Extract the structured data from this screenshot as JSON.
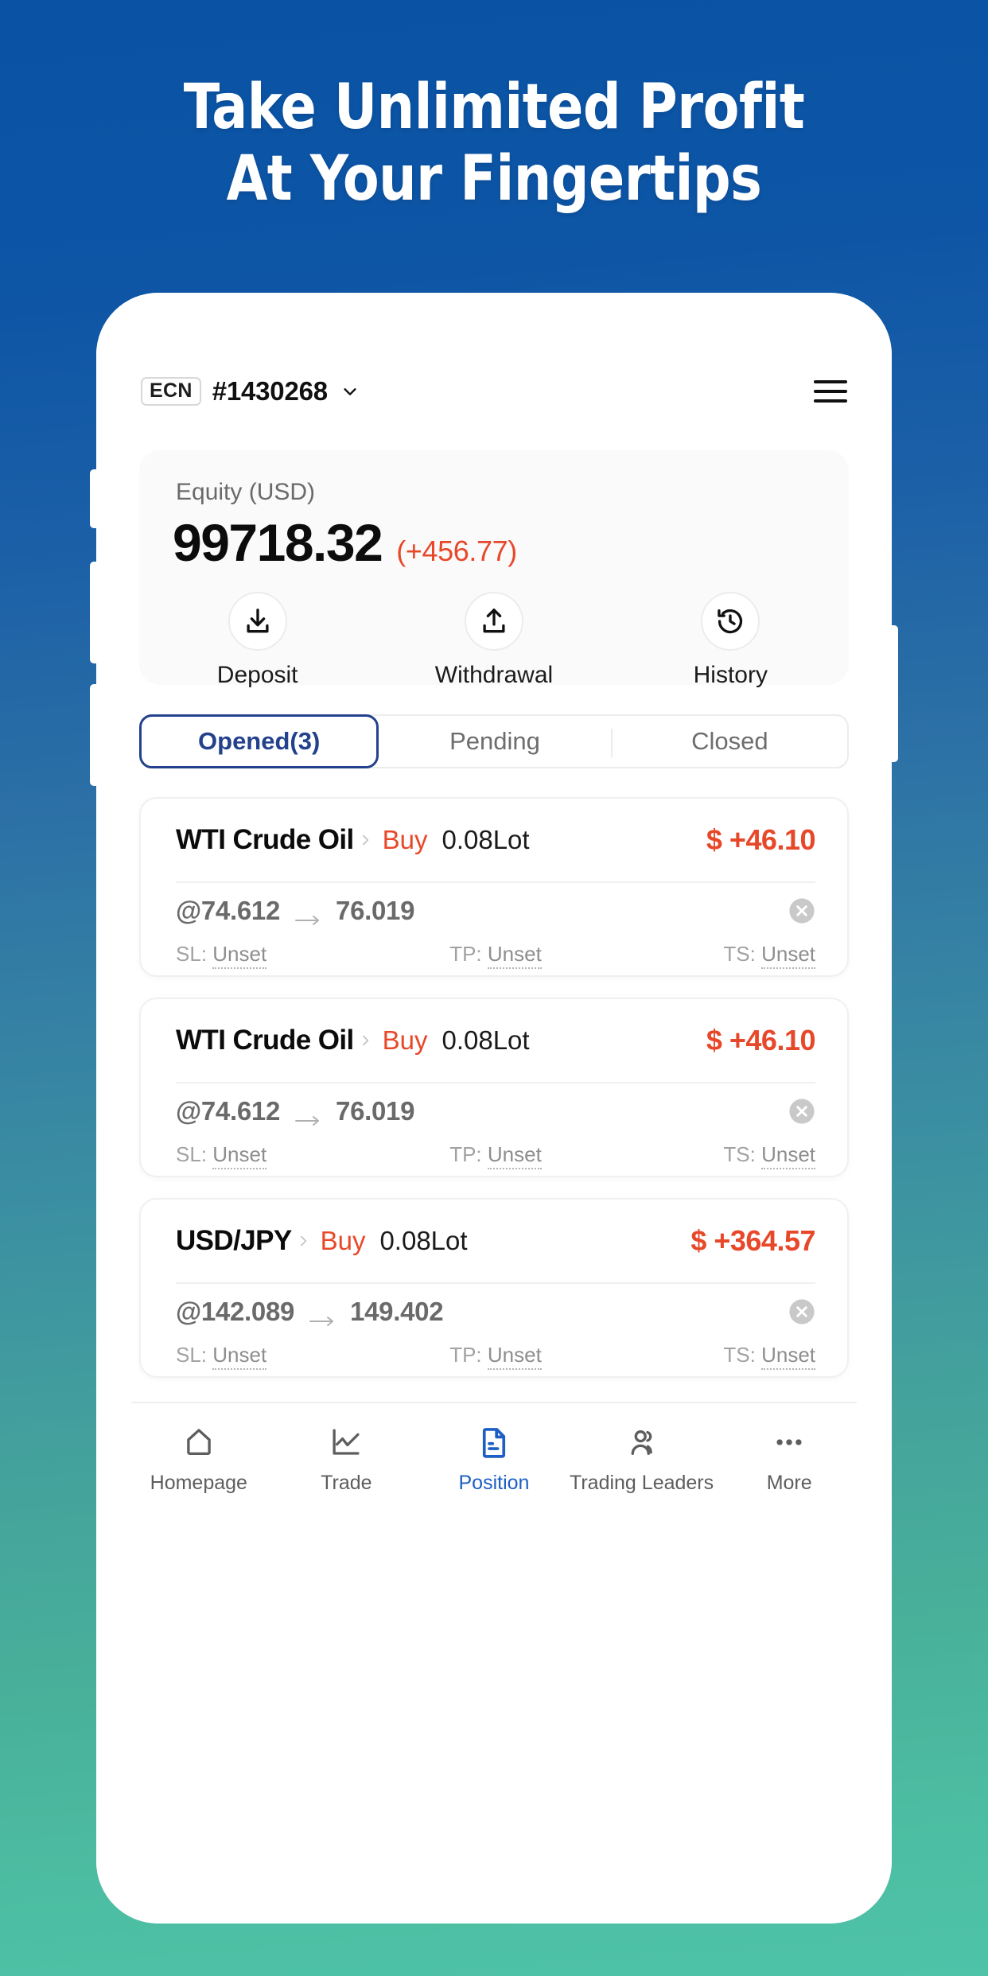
{
  "hero": {
    "line1": "Take Unlimited Profit",
    "line2": "At Your Fingertips"
  },
  "colors": {
    "bg_top": "#0A52A4",
    "bg_bottom": "#4EC3A8",
    "accent_red": "#E8482A",
    "accent_blue": "#23418C",
    "nav_active_blue": "#1D5FC4"
  },
  "app": {
    "header": {
      "account_type_badge": "ECN",
      "account_number": "#1430268",
      "chevron_icon": "chevron-down-icon",
      "menu_icon": "hamburger-menu-icon"
    },
    "equity_card": {
      "label": "Equity (USD)",
      "value": "99718.32",
      "change": "(+456.77)",
      "actions": [
        {
          "label": "Deposit",
          "icon": "download-arrow-icon"
        },
        {
          "label": "Withdrawal",
          "icon": "upload-arrow-icon"
        },
        {
          "label": "History",
          "icon": "clock-rewind-icon"
        }
      ]
    },
    "tabs": [
      {
        "label": "Opened(3)",
        "active": true
      },
      {
        "label": "Pending",
        "active": false
      },
      {
        "label": "Closed",
        "active": false
      }
    ],
    "positions": [
      {
        "symbol": "WTI Crude Oil",
        "side": "Buy",
        "lot": "0.08Lot",
        "pnl": "$ +46.10",
        "open_price": "@74.612",
        "current_price": "76.019",
        "sl_label": "SL:",
        "sl_value": "Unset",
        "tp_label": "TP:",
        "tp_value": "Unset",
        "ts_label": "TS:",
        "ts_value": "Unset"
      },
      {
        "symbol": "WTI Crude Oil",
        "side": "Buy",
        "lot": "0.08Lot",
        "pnl": "$ +46.10",
        "open_price": "@74.612",
        "current_price": "76.019",
        "sl_label": "SL:",
        "sl_value": "Unset",
        "tp_label": "TP:",
        "tp_value": "Unset",
        "ts_label": "TS:",
        "ts_value": "Unset"
      },
      {
        "symbol": "USD/JPY",
        "side": "Buy",
        "lot": "0.08Lot",
        "pnl": "$ +364.57",
        "open_price": "@142.089",
        "current_price": "149.402",
        "sl_label": "SL:",
        "sl_value": "Unset",
        "tp_label": "TP:",
        "tp_value": "Unset",
        "ts_label": "TS:",
        "ts_value": "Unset"
      }
    ],
    "bottom_nav": [
      {
        "label": "Homepage",
        "icon": "home-icon",
        "active": false
      },
      {
        "label": "Trade",
        "icon": "line-chart-icon",
        "active": false
      },
      {
        "label": "Position",
        "icon": "document-icon",
        "active": true
      },
      {
        "label": "Trading Leaders",
        "icon": "people-icon",
        "active": false
      },
      {
        "label": "More",
        "icon": "ellipsis-icon",
        "active": false
      }
    ]
  }
}
